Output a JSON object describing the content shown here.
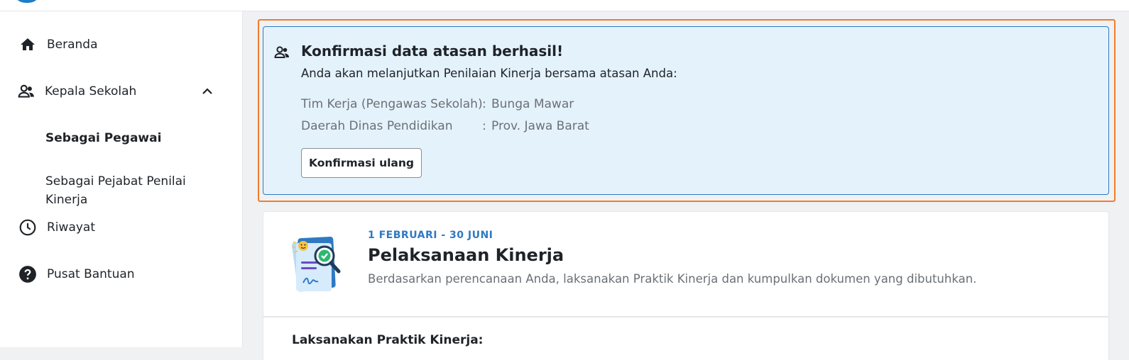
{
  "sidebar": {
    "items": [
      {
        "label": "Beranda",
        "icon": "home-icon"
      },
      {
        "label": "Kepala Sekolah",
        "icon": "people-icon",
        "expanded": true,
        "children": [
          {
            "label": "Sebagai Pegawai",
            "active": true
          },
          {
            "label": "Sebagai Pejabat Penilai Kinerja",
            "active": false
          }
        ]
      },
      {
        "label": "Riwayat",
        "icon": "clock-icon"
      },
      {
        "label": "Pusat Bantuan",
        "icon": "help-icon"
      }
    ]
  },
  "alert": {
    "icon": "people-icon",
    "title": "Konfirmasi data atasan berhasil!",
    "description": "Anda akan melanjutkan Penilaian Kinerja bersama atasan Anda:",
    "rows": [
      {
        "label": "Tim Kerja (Pengawas Sekolah)",
        "separator": ":",
        "value": "Bunga Mawar"
      },
      {
        "label": "Daerah Dinas Pendidikan",
        "separator": ":",
        "value": "Prov. Jawa Barat"
      }
    ],
    "button_label": "Konfirmasi ulang",
    "highlight_color": "#ef7d2d",
    "background_color": "#e4f2fc"
  },
  "card": {
    "illustration": "document-search-check-illustration",
    "date_range": "1 FEBRUARI - 30 JUNI",
    "title": "Pelaksanaan Kinerja",
    "description": "Berdasarkan perencanaan Anda, laksanakan Praktik Kinerja dan kumpulkan dokumen yang dibutuhkan.",
    "accent_color": "#2f79c2"
  },
  "section": {
    "heading": "Laksanakan Praktik Kinerja:"
  }
}
